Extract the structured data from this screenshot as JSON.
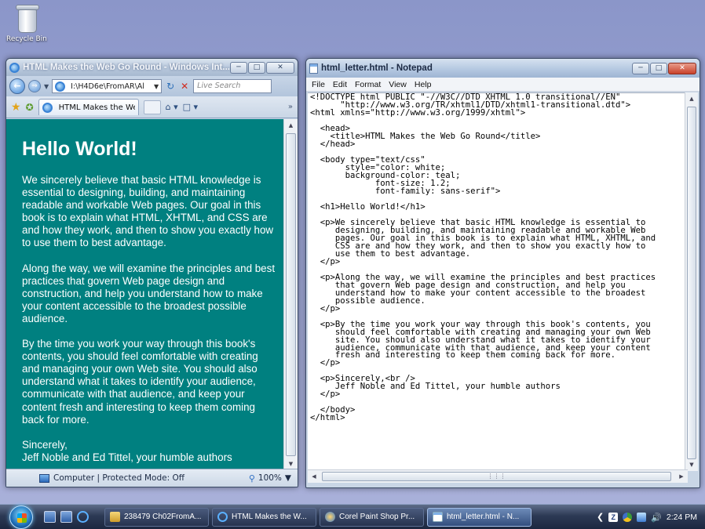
{
  "desktop": {
    "recycle_bin_label": "Recycle Bin"
  },
  "ie": {
    "title": "HTML Makes the Web Go Round - Windows Int...",
    "address": "I:\\H4D6e\\FromAR\\Al",
    "search_placeholder": "Live Search",
    "tab_title": "HTML Makes the Web G...",
    "status_zone": "Computer | Protected Mode: Off",
    "zoom": "100%",
    "page": {
      "heading": "Hello World!",
      "paragraphs": [
        "We sincerely believe that basic HTML knowledge is essential to designing, building, and maintaining readable and workable Web pages. Our goal in this book is to explain what HTML, XHTML, and CSS are and how they work, and then to show you exactly how to use them to best advantage.",
        "Along the way, we will examine the principles and best practices that govern Web page design and construction, and help you understand how to make your content accessible to the broadest possible audience.",
        "By the time you work your way through this book's contents, you should feel comfortable with creating and managing your own Web site. You should also understand what it takes to identify your audience, communicate with that audience, and keep your content fresh and interesting to keep them coming back for more.",
        "Sincerely,",
        "Jeff Noble and Ed Tittel, your humble authors"
      ]
    }
  },
  "notepad": {
    "title": "html_letter.html - Notepad",
    "menu": [
      "File",
      "Edit",
      "Format",
      "View",
      "Help"
    ],
    "content": "<!DOCTYPE html PUBLIC \"-//W3C//DTD XHTML 1.0 transitional//EN\"\n      \"http://www.w3.org/TR/xhtml1/DTD/xhtml1-transitional.dtd\">\n<html xmlns=\"http://www.w3.org/1999/xhtml\">\n\n  <head>\n    <title>HTML Makes the Web Go Round</title>\n  </head>\n\n  <body type=\"text/css\"\n       style=\"color: white;\n       background-color: teal;\n             font-size: 1.2;\n             font-family: sans-serif\">\n\n  <h1>Hello World!</h1>\n\n  <p>We sincerely believe that basic HTML knowledge is essential to\n     designing, building, and maintaining readable and workable Web\n     pages. Our goal in this book is to explain what HTML, XHTML, and\n     CSS are and how they work, and then to show you exactly how to\n     use them to best advantage.\n  </p>\n\n  <p>Along the way, we will examine the principles and best practices\n     that govern Web page design and construction, and help you\n     understand how to make your content accessible to the broadest\n     possible audience.\n  </p>\n\n  <p>By the time you work your way through this book's contents, you\n     should feel comfortable with creating and managing your own Web\n     site. You should also understand what it takes to identify your\n     audience, communicate with that audience, and keep your content\n     fresh and interesting to keep them coming back for more.\n  </p>\n\n  <p>Sincerely,<br />\n     Jeff Noble and Ed Tittel, your humble authors\n  </p>\n\n  </body>\n</html>"
  },
  "taskbar": {
    "tasks": [
      {
        "label": "238479 Ch02FromA...",
        "icon": "folder-icon"
      },
      {
        "label": "HTML Makes the W...",
        "icon": "ie-icon"
      },
      {
        "label": "Corel Paint Shop Pr...",
        "icon": "paint-shop-icon"
      },
      {
        "label": "html_letter.html - N...",
        "icon": "notepad-icon",
        "active": true
      }
    ],
    "clock": "2:24 PM"
  },
  "colors": {
    "page_background": "#008080",
    "page_text": "#ffffff"
  }
}
